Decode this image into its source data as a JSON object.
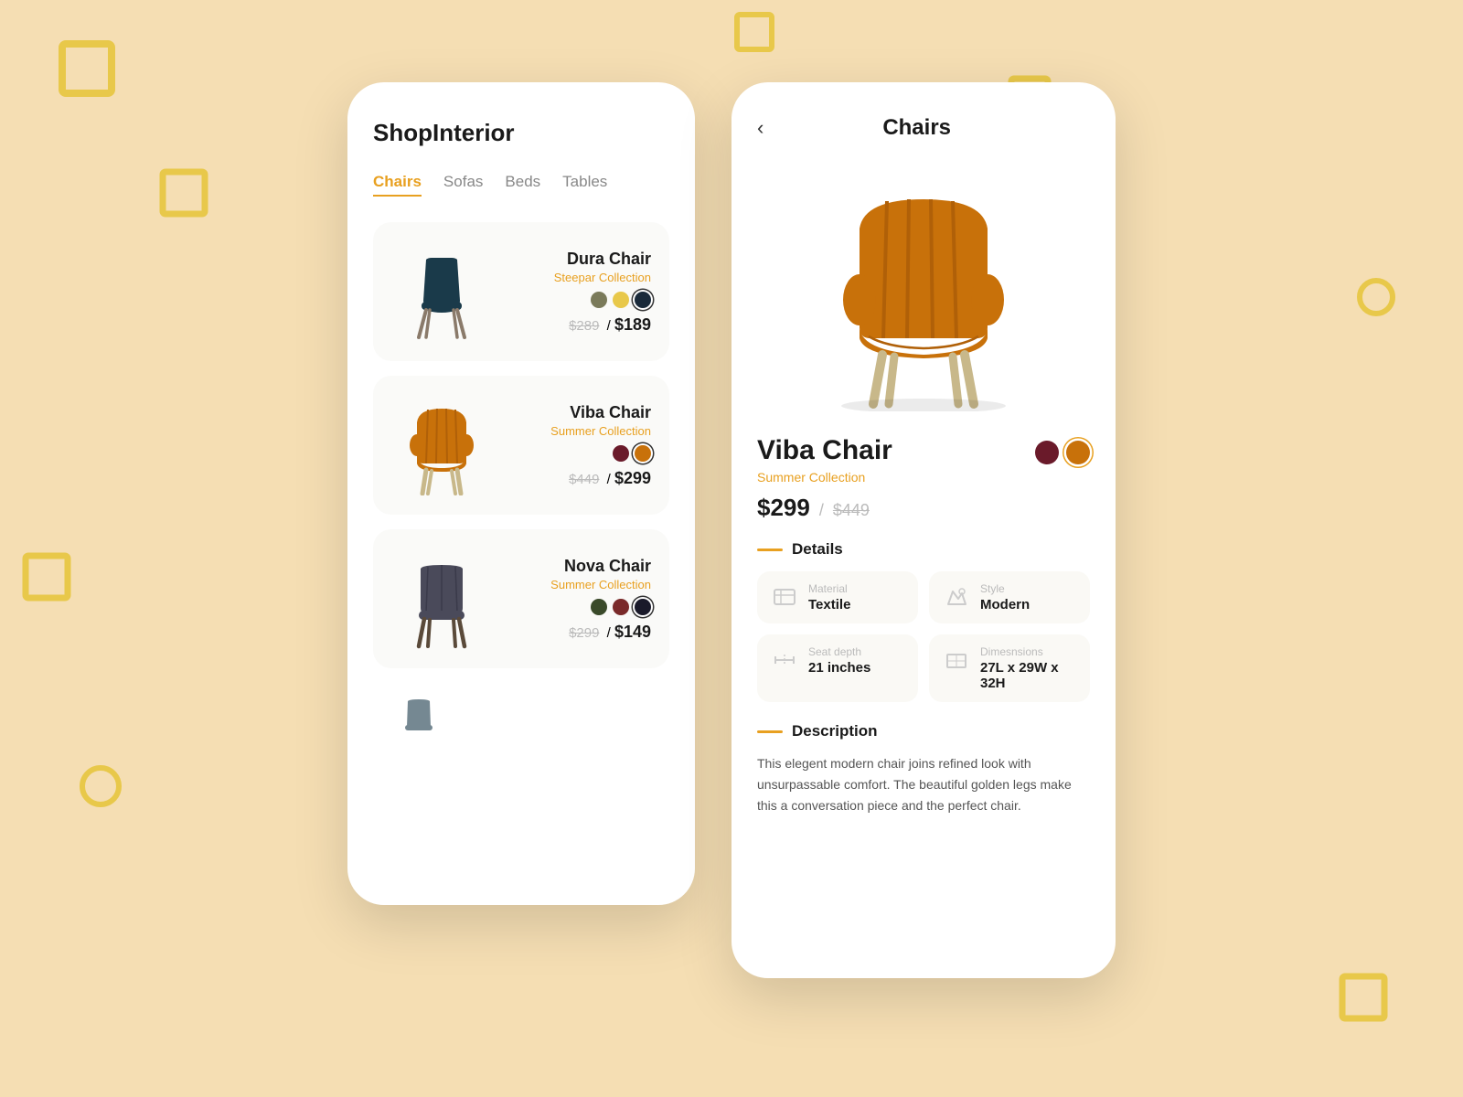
{
  "background": {
    "color": "#f5deb3"
  },
  "left_phone": {
    "app_title": "ShopInterior",
    "categories": [
      {
        "label": "Chairs",
        "active": true
      },
      {
        "label": "Sofas",
        "active": false
      },
      {
        "label": "Beds",
        "active": false
      },
      {
        "label": "Tables",
        "active": false
      }
    ],
    "products": [
      {
        "name": "Dura Chair",
        "collection": "Steepar Collection",
        "swatches": [
          "#7a7a5a",
          "#e8c84a",
          "#1a2a3a"
        ],
        "selected_swatch": 2,
        "price_old": "$289",
        "price_new": "$189",
        "chair_color": "#1a3a4a",
        "leg_color": "#8a7a6a"
      },
      {
        "name": "Viba Chair",
        "collection": "Summer Collection",
        "swatches": [
          "#6a1a2a",
          "#c8710a"
        ],
        "selected_swatch": 1,
        "price_old": "$449",
        "price_new": "$299",
        "chair_color": "#c8710a",
        "leg_color": "#c8b88a"
      },
      {
        "name": "Nova Chair",
        "collection": "Summer Collection",
        "swatches": [
          "#3a4a2a",
          "#7a2a2a",
          "#1a1a2a"
        ],
        "selected_swatch": 2,
        "price_old": "$299",
        "price_new": "$149",
        "chair_color": "#4a4a5a",
        "leg_color": "#5a4a3a"
      }
    ]
  },
  "right_phone": {
    "back_label": "‹",
    "title": "Chairs",
    "product": {
      "name": "Viba Chair",
      "collection": "Summer Collection",
      "swatches": [
        "#6a1a2a",
        "#c8710a"
      ],
      "selected_swatch": 1,
      "price_new": "$299",
      "price_old": "$449",
      "details_label": "Details",
      "description_label": "Description",
      "specs": [
        {
          "icon": "material-icon",
          "label": "Material",
          "value": "Textile"
        },
        {
          "icon": "style-icon",
          "label": "Style",
          "value": "Modern"
        },
        {
          "icon": "seat-depth-icon",
          "label": "Seat depth",
          "value": "21 inches"
        },
        {
          "icon": "dimensions-icon",
          "label": "Dimesnsions",
          "value": "27L x 29W x 32H"
        }
      ],
      "description": "This elegent modern chair joins refined look with unsurpassable comfort. The beautiful golden legs make this a conversation piece and the perfect chair."
    }
  }
}
